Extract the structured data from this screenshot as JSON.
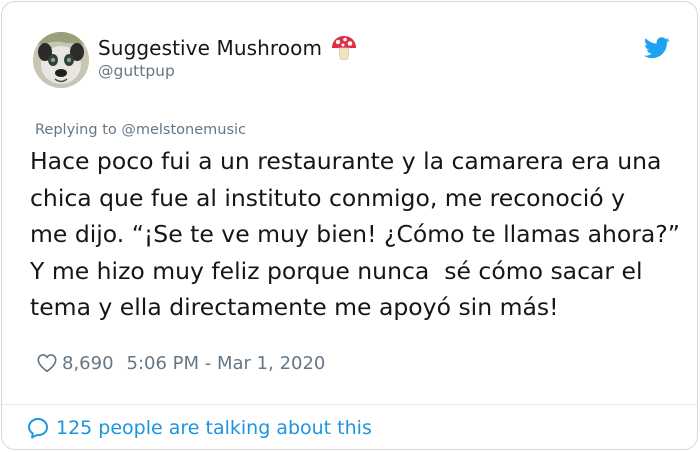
{
  "tweet": {
    "author": {
      "display_name": "Suggestive Mushroom",
      "handle": "@guttpup",
      "name_emoji_icon": "mushroom-icon"
    },
    "brand_icon": "twitter-bird-icon",
    "reply_prefix": "Replying to",
    "reply_to": "@melstonemusic",
    "text": "Hace poco fui a un restaurante y la camarera era una\nchica que fue al instituto conmigo, me reconoció y\nme dijo. “¡Se te ve muy bien! ¿Cómo te llamas ahora?”\nY me hizo muy feliz porque nunca  sé cómo sacar el\ntema y ella directamente me apoyó sin más!",
    "likes": "8,690",
    "timestamp": "5:06 PM - Mar 1, 2020",
    "conversation": "125 people are talking about this"
  },
  "colors": {
    "secondary_text": "#657786",
    "link": "#1b95e0",
    "twitter_blue": "#1da1f2",
    "border": "#cfd9de"
  }
}
